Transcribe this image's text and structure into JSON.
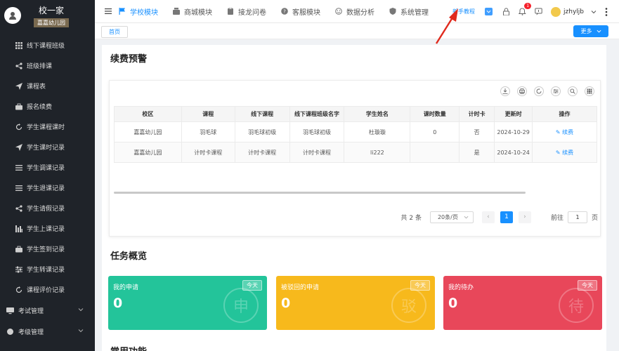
{
  "brand": {
    "title": "校一家",
    "sub": "嘉嘉幼儿园"
  },
  "sidebar": {
    "items": [
      {
        "label": "线下课程班级",
        "icon": "grid-icon"
      },
      {
        "label": "班级排课",
        "icon": "share-icon"
      },
      {
        "label": "课程表",
        "icon": "send-icon"
      },
      {
        "label": "报名续费",
        "icon": "briefcase-icon"
      },
      {
        "label": "学生课程课时",
        "icon": "refresh-icon"
      },
      {
        "label": "学生课时记录",
        "icon": "send-icon"
      },
      {
        "label": "学生调课记录",
        "icon": "list-icon"
      },
      {
        "label": "学生退课记录",
        "icon": "list-icon"
      },
      {
        "label": "学生请假记录",
        "icon": "share-icon"
      },
      {
        "label": "学生上课记录",
        "icon": "bar-icon"
      },
      {
        "label": "学生签到记录",
        "icon": "briefcase-icon"
      },
      {
        "label": "学生转课记录",
        "icon": "sliders-icon"
      },
      {
        "label": "课程评价记录",
        "icon": "refresh-icon"
      }
    ],
    "group_exam": "考试管理",
    "group_next": "考级管理"
  },
  "topnav": {
    "items": [
      {
        "label": "学校模块",
        "active": true
      },
      {
        "label": "商城模块",
        "active": false
      },
      {
        "label": "接龙问卷",
        "active": false
      },
      {
        "label": "客服模块",
        "active": false
      },
      {
        "label": "数据分析",
        "active": false
      },
      {
        "label": "系统管理",
        "active": false
      }
    ],
    "guide": "新手教程",
    "bell_count": "1",
    "user": "jzhyljb"
  },
  "tabs": {
    "home": "首页",
    "more": "更多"
  },
  "warning": {
    "title": "续费预警",
    "columns": [
      "校区",
      "课程",
      "线下课程",
      "线下课程班级名字",
      "学生姓名",
      "课时数量",
      "计时卡",
      "更新时",
      "操作"
    ],
    "rows": [
      {
        "campus": "嘉嘉幼儿园",
        "course": "羽毛球",
        "offline": "羽毛球初级",
        "class_name": "羽毛球初级",
        "student": "杜璇璇",
        "hours": "0",
        "timecard": "否",
        "updated": "2024-10-29",
        "action": "续费"
      },
      {
        "campus": "嘉嘉幼儿园",
        "course": "计时卡课程",
        "offline": "计时卡课程",
        "class_name": "计时卡课程",
        "student": "li222",
        "hours": "",
        "timecard": "是",
        "updated": "2024-10-24",
        "action": "续费"
      }
    ],
    "pager": {
      "total": "共 2 条",
      "size": "20条/页",
      "current": "1",
      "goto": "前往",
      "page_input": "1",
      "page_unit": "页",
      "prev": "‹",
      "next": "›"
    }
  },
  "tasks": {
    "title": "任务概览",
    "cards": [
      {
        "label": "我的申请",
        "badge": "今天",
        "count": "0",
        "stamp": "申",
        "color": "#23c49a"
      },
      {
        "label": "被驳回的申请",
        "badge": "今天",
        "count": "0",
        "stamp": "驳",
        "color": "#f7b91c"
      },
      {
        "label": "我的待办",
        "badge": "今天",
        "count": "0",
        "stamp": "待",
        "color": "#e8475a"
      }
    ]
  },
  "common": {
    "title": "常用功能"
  },
  "colors": {
    "primary": "#1890ff",
    "sidebar": "#1f2329",
    "arrow": "#e02a1d"
  }
}
